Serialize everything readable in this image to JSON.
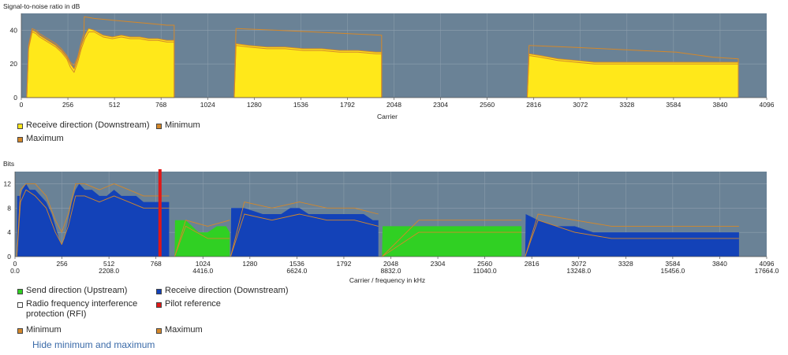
{
  "colors": {
    "plot_bg": "#6a8296",
    "grid": "#8fa0ae",
    "downstream_snr": "#ffe81a",
    "minmax": "#d4882a",
    "upstream": "#30d023",
    "downstream_bits": "#1342b8",
    "pilot": "#e01818",
    "rfi": "#ffffff"
  },
  "chart_data": [
    {
      "type": "area",
      "title": "",
      "ylabel": "Signal-to-noise ratio in dB",
      "xlabel": "Carrier",
      "xlim": [
        0,
        4096
      ],
      "ylim": [
        0,
        50
      ],
      "x_ticks": [
        "0",
        "256",
        "512",
        "768",
        "1024",
        "1280",
        "1536",
        "1792",
        "2048",
        "2304",
        "2560",
        "2816",
        "3072",
        "3328",
        "3584",
        "3840",
        "4096"
      ],
      "y_ticks": [
        "0",
        "20",
        "40"
      ],
      "grid": true,
      "legend_placement": "bottom-left",
      "legend": [
        "Receive direction (Downstream)",
        "Minimum",
        "Maximum"
      ],
      "series": [
        {
          "name": "Receive direction (Downstream)",
          "segments": [
            {
              "x": [
                30,
                40,
                60,
                80,
                100,
                130,
                160,
                190,
                220,
                250,
                270,
                290,
                310,
                330,
                350,
                370,
                400,
                450,
                500,
                550,
                600,
                650,
                700,
                750,
                800,
                840
              ],
              "y": [
                0,
                30,
                40,
                39,
                37,
                35,
                33,
                31,
                28,
                24,
                20,
                17,
                23,
                31,
                37,
                41,
                40,
                37,
                36,
                37,
                36,
                36,
                35,
                35,
                34,
                34
              ]
            },
            {
              "x": [
                1170,
                1180,
                1250,
                1350,
                1450,
                1550,
                1650,
                1750,
                1850,
                1950,
                1980
              ],
              "y": [
                0,
                32,
                31,
                30,
                30,
                29,
                29,
                28,
                28,
                27,
                27
              ]
            },
            {
              "x": [
                2780,
                2790,
                2850,
                2950,
                3050,
                3150,
                3250,
                3350,
                3450,
                3550,
                3650,
                3750,
                3850,
                3940
              ],
              "y": [
                0,
                26,
                25,
                23,
                22,
                21,
                21,
                21,
                21,
                21,
                21,
                21,
                21,
                21
              ]
            }
          ]
        },
        {
          "name": "Minimum",
          "segments": [
            {
              "x": [
                30,
                40,
                60,
                80,
                100,
                130,
                160,
                190,
                220,
                250,
                270,
                290,
                310,
                330,
                350,
                370,
                400,
                450,
                500,
                550,
                600,
                650,
                700,
                750,
                800,
                840
              ],
              "y": [
                0,
                29,
                39,
                38,
                36,
                34,
                32,
                30,
                27,
                23,
                18,
                15,
                21,
                29,
                35,
                39,
                39,
                36,
                35,
                36,
                35,
                35,
                34,
                34,
                33,
                33
              ]
            },
            {
              "x": [
                1170,
                1180,
                1250,
                1350,
                1450,
                1550,
                1650,
                1750,
                1850,
                1950,
                1980
              ],
              "y": [
                0,
                31,
                30,
                29,
                29,
                28,
                28,
                27,
                27,
                26,
                26
              ]
            },
            {
              "x": [
                2780,
                2790,
                2850,
                2950,
                3050,
                3150,
                3250,
                3350,
                3450,
                3550,
                3650,
                3750,
                3850,
                3940
              ],
              "y": [
                0,
                25,
                24,
                22,
                21,
                20,
                20,
                20,
                20,
                20,
                20,
                20,
                20,
                20
              ]
            }
          ]
        },
        {
          "name": "Maximum",
          "segments": [
            {
              "x": [
                30,
                40,
                60,
                80,
                100,
                130,
                160,
                190,
                220,
                250,
                270,
                290,
                310,
                330,
                344,
                346,
                400,
                500,
                600,
                700,
                800,
                840,
                840
              ],
              "y": [
                0,
                31,
                41,
                40,
                38,
                36,
                34,
                32,
                29,
                25,
                21,
                19,
                24,
                33,
                38,
                48,
                47,
                46,
                45,
                44,
                43,
                43,
                0
              ]
            },
            {
              "x": [
                1170,
                1180,
                1400,
                1600,
                1800,
                1980,
                1980
              ],
              "y": [
                0,
                41,
                40,
                39,
                38,
                37,
                0
              ]
            },
            {
              "x": [
                2780,
                2790,
                3000,
                3200,
                3400,
                3600,
                3800,
                3940,
                3940
              ],
              "y": [
                0,
                31,
                30,
                29,
                28,
                27,
                24,
                23,
                0
              ]
            }
          ]
        }
      ]
    },
    {
      "type": "area",
      "title": "",
      "ylabel": "Bits",
      "xlabel": "Carrier / frequency in kHz",
      "xlim": [
        0,
        4096
      ],
      "ylim": [
        0,
        14
      ],
      "x_ticks": [
        "0",
        "256",
        "512",
        "768",
        "1024",
        "1280",
        "1536",
        "1792",
        "2048",
        "2304",
        "2560",
        "2816",
        "3072",
        "3328",
        "3584",
        "3840",
        "4096"
      ],
      "x_ticks_khz": [
        {
          "carrier": 0,
          "label": "0.0"
        },
        {
          "carrier": 512,
          "label": "2208.0"
        },
        {
          "carrier": 1024,
          "label": "4416.0"
        },
        {
          "carrier": 1536,
          "label": "6624.0"
        },
        {
          "carrier": 2048,
          "label": "8832.0"
        },
        {
          "carrier": 2560,
          "label": "11040.0"
        },
        {
          "carrier": 3072,
          "label": "13248.0"
        },
        {
          "carrier": 3584,
          "label": "15456.0"
        },
        {
          "carrier": 4096,
          "label": "17664.0"
        }
      ],
      "y_ticks": [
        "0",
        "4",
        "8",
        "12"
      ],
      "grid": true,
      "legend_placement": "bottom-left",
      "legend": [
        "Send direction (Upstream)",
        "Receive direction (Downstream)",
        "Radio frequency interference protection (RFI)",
        "Pilot reference",
        "Minimum",
        "Maximum"
      ],
      "pilot_carrier": 790,
      "series": [
        {
          "name": "Receive direction (Downstream)",
          "segments": [
            {
              "x": [
                10,
                12,
                30,
                40,
                60,
                80,
                110,
                140,
                170,
                200,
                220,
                240,
                255,
                270,
                290,
                310,
                330,
                350,
                380,
                420,
                460,
                500,
                540,
                580,
                620,
                660,
                700,
                740,
                780,
                820,
                840
              ],
              "y": [
                0,
                10,
                10,
                11,
                12,
                11,
                11,
                10,
                9,
                7,
                5,
                3,
                2,
                3,
                6,
                9,
                11,
                12,
                11,
                11,
                10,
                10,
                11,
                10,
                10,
                10,
                9,
                9,
                9,
                9,
                9
              ]
            },
            {
              "x": [
                1175,
                1178,
                1250,
                1350,
                1400,
                1450,
                1500,
                1550,
                1600,
                1650,
                1700,
                1750,
                1800,
                1850,
                1900,
                1950,
                1980
              ],
              "y": [
                0,
                8,
                8,
                7,
                7,
                7,
                8,
                8,
                7,
                7,
                7,
                7,
                7,
                7,
                7,
                6,
                6
              ]
            },
            {
              "x": [
                2780,
                2783,
                2850,
                2950,
                3050,
                3150,
                3250,
                3350,
                3450,
                3550,
                3650,
                3750,
                3850,
                3945
              ],
              "y": [
                0,
                7,
                6,
                5,
                5,
                4,
                4,
                4,
                4,
                4,
                4,
                4,
                4,
                4
              ]
            }
          ]
        },
        {
          "name": "Send direction (Upstream)",
          "segments": [
            {
              "x": [
                870,
                872,
                930,
                1000,
                1050,
                1100,
                1150,
                1170
              ],
              "y": [
                0,
                6,
                6,
                4,
                4,
                5,
                5,
                4
              ]
            },
            {
              "x": [
                2000,
                2003,
                2100,
                2200,
                2300,
                2400,
                2500,
                2600,
                2700,
                2760
              ],
              "y": [
                0,
                5,
                5,
                5,
                5,
                5,
                5,
                5,
                5,
                5
              ]
            }
          ]
        },
        {
          "name": "Minimum",
          "segments": [
            {
              "x": [
                10,
                30,
                60,
                110,
                170,
                220,
                255,
                290,
                330,
                380,
                460,
                540,
                620,
                700,
                780,
                840
              ],
              "y": [
                0,
                9,
                11,
                10,
                8,
                4,
                2,
                5,
                10,
                10,
                9,
                10,
                9,
                8,
                8,
                8
              ]
            },
            {
              "x": [
                1175,
                1250,
                1400,
                1550,
                1700,
                1850,
                1980
              ],
              "y": [
                0,
                7,
                6,
                7,
                6,
                6,
                5
              ]
            },
            {
              "x": [
                2780,
                2850,
                3050,
                3250,
                3450,
                3650,
                3850,
                3945
              ],
              "y": [
                0,
                6,
                4,
                3,
                3,
                3,
                3,
                3
              ]
            },
            {
              "x": [
                870,
                930,
                1050,
                1170
              ],
              "y": [
                0,
                5,
                3,
                3
              ]
            },
            {
              "x": [
                2000,
                2200,
                2400,
                2600,
                2760
              ],
              "y": [
                0,
                4,
                4,
                4,
                4
              ]
            }
          ]
        },
        {
          "name": "Maximum",
          "segments": [
            {
              "x": [
                10,
                30,
                60,
                110,
                170,
                220,
                255,
                290,
                330,
                380,
                460,
                540,
                620,
                700,
                780,
                840
              ],
              "y": [
                0,
                11,
                12,
                12,
                10,
                6,
                4,
                7,
                12,
                12,
                11,
                12,
                11,
                10,
                10,
                10
              ]
            },
            {
              "x": [
                1175,
                1250,
                1400,
                1550,
                1700,
                1850,
                1980
              ],
              "y": [
                0,
                9,
                8,
                9,
                8,
                8,
                7
              ]
            },
            {
              "x": [
                2780,
                2850,
                3050,
                3250,
                3450,
                3650,
                3850,
                3945
              ],
              "y": [
                0,
                7,
                6,
                5,
                5,
                5,
                5,
                5
              ]
            },
            {
              "x": [
                870,
                930,
                1050,
                1170
              ],
              "y": [
                0,
                6,
                5,
                6
              ]
            },
            {
              "x": [
                2000,
                2200,
                2400,
                2600,
                2760
              ],
              "y": [
                0,
                6,
                6,
                6,
                6
              ]
            }
          ]
        }
      ]
    }
  ],
  "ui": {
    "hide_link": "Hide minimum and maximum"
  }
}
